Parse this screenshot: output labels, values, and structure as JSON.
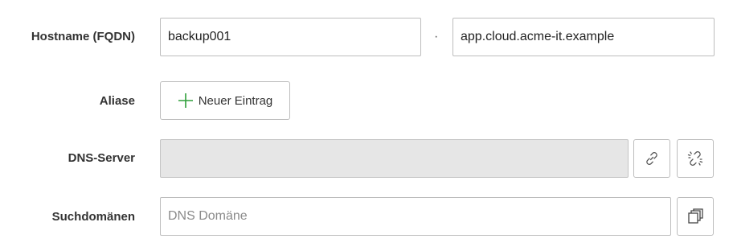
{
  "hostname": {
    "label": "Hostname (FQDN)",
    "host_value": "backup001",
    "separator": "·",
    "domain_value": "app.cloud.acme-it.example"
  },
  "aliases": {
    "label": "Aliase",
    "add_button_label": "Neuer Eintrag",
    "add_icon": "plus-icon",
    "accent_color": "#2e9e3a"
  },
  "dns_server": {
    "label": "DNS-Server",
    "value": "",
    "link_icon": "link-icon",
    "unlink_icon": "unlink-icon"
  },
  "search_domains": {
    "label": "Suchdomänen",
    "placeholder": "DNS Domäne",
    "copy_icon": "copy-icon"
  }
}
